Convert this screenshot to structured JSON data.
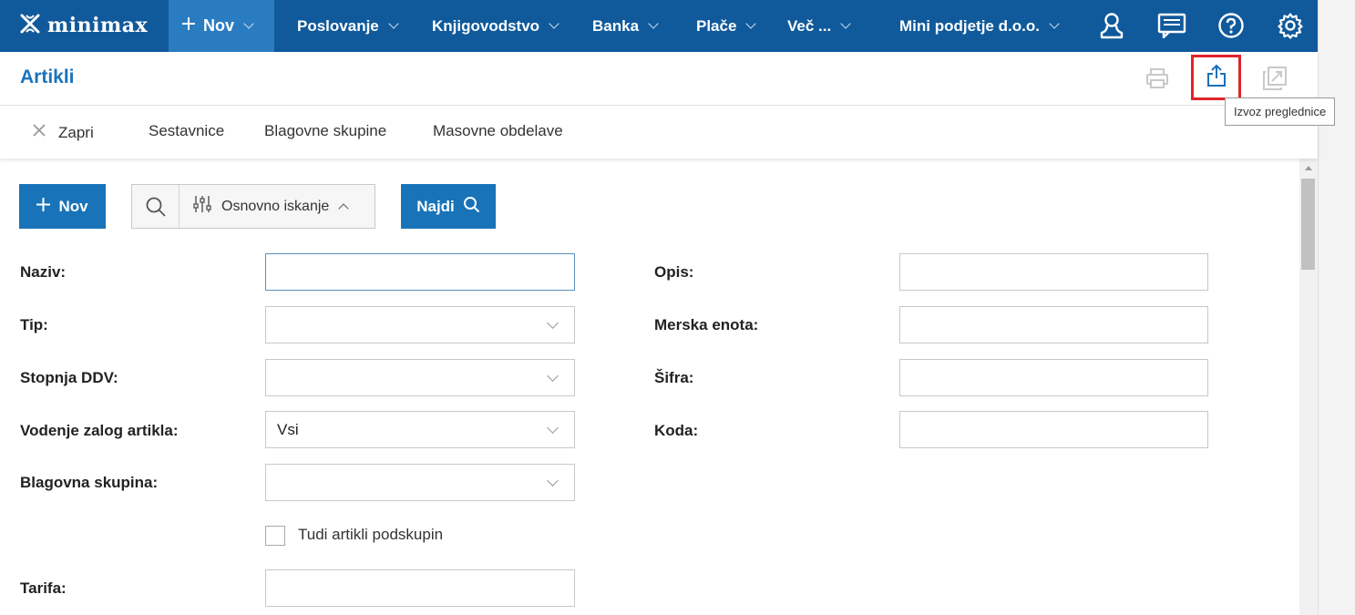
{
  "nav": {
    "brand": "minimax",
    "new_label": "Nov",
    "items": [
      "Poslovanje",
      "Knjigovodstvo",
      "Banka",
      "Plače",
      "Več ..."
    ],
    "company": "Mini podjetje d.o.o.",
    "icons": [
      "user-icon",
      "messages-icon",
      "help-icon",
      "settings-icon"
    ]
  },
  "header": {
    "title": "Artikli",
    "tooltip": "Izvoz preglednice",
    "icons": [
      "print-icon",
      "export-icon",
      "popout-icon"
    ]
  },
  "actions": {
    "close_label": "Zapri",
    "items": [
      "Sestavnice",
      "Blagovne skupine",
      "Masovne obdelave"
    ]
  },
  "search": {
    "new_label": "Nov",
    "mode_label": "Osnovno iskanje",
    "find_label": "Najdi"
  },
  "form": {
    "left": {
      "naziv": {
        "label": "Naziv:",
        "value": ""
      },
      "tip": {
        "label": "Tip:",
        "value": ""
      },
      "stopnja_ddv": {
        "label": "Stopnja DDV:",
        "value": ""
      },
      "vodenje_zalog": {
        "label": "Vodenje zalog artikla:",
        "value": "Vsi"
      },
      "blagovna_skupina": {
        "label": "Blagovna skupina:",
        "value": ""
      },
      "podskupine_checkbox": {
        "label": "Tudi artikli podskupin",
        "checked": false
      },
      "tarifa": {
        "label": "Tarifa:",
        "value": ""
      }
    },
    "right": {
      "opis": {
        "label": "Opis:",
        "value": ""
      },
      "merska_enota": {
        "label": "Merska enota:",
        "value": ""
      },
      "sifra": {
        "label": "Šifra:",
        "value": ""
      },
      "koda": {
        "label": "Koda:",
        "value": ""
      }
    }
  },
  "colors": {
    "nav_bg": "#105a9b",
    "nav_active": "#2a7cc1",
    "primary_button": "#1873b8",
    "title": "#1b73bd",
    "highlight": "#e2232a"
  }
}
